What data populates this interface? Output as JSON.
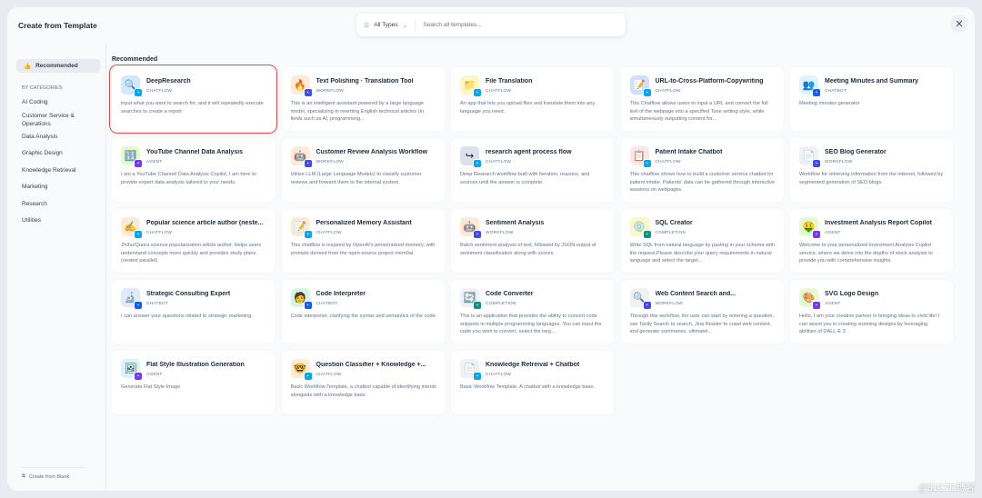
{
  "header": {
    "title": "Create from Template",
    "close": "✕",
    "filter_label": "All Types",
    "search_placeholder": "Search all templates..."
  },
  "sidebar": {
    "recommended": "Recommended",
    "by_categories": "BY CATEGORIES",
    "categories": [
      "AI Coding",
      "Customer Service & Operations",
      "Data Analysis",
      "Graphic Design",
      "Knowledge Retrieval",
      "Marketing",
      "Research",
      "Utilities"
    ],
    "create_blank": "Create from Blank"
  },
  "main": {
    "section_title": "Recommended",
    "templates": [
      {
        "name": "DeepResearch",
        "type": "CHATFLOW",
        "desc": "input what you want to search for, and it will repeatedly execute searches to create a report",
        "icon": "🔍",
        "bg": "#d1e9ff",
        "selected": true
      },
      {
        "name": "Text Polishing · Translation Tool",
        "type": "WORKFLOW",
        "desc": "This is an intelligent assistant powered by a large language model, specializing in rewriting English technical articles (in fields such as AI, programming...",
        "icon": "🔥",
        "bg": "#ffead5"
      },
      {
        "name": "File Translation",
        "type": "CHATFLOW",
        "desc": "An app that lets you upload files and translate them into any language you need.",
        "icon": "📁",
        "bg": "#fef7c3"
      },
      {
        "name": "URL-to-Cross-Platform-Copywriting",
        "type": "CHATFLOW",
        "desc": "This Chatflow allows users to input a URL and convert the full text of the webpage into a specified Tone writing style, while simultaneously outputting content for...",
        "icon": "📝",
        "bg": "#d1e0ff"
      },
      {
        "name": "Meeting Minutes and Summary",
        "type": "CHATBOT",
        "desc": "Meeting minutes generator",
        "icon": "👥",
        "bg": "#e0f2fe"
      },
      {
        "name": "YouTube Channel Data Analysis",
        "type": "AGENT",
        "desc": "I am a YouTube Channel Data Analysis Copilot, I am here to provide expert data analysis tailored to your needs.",
        "icon": "🔢",
        "bg": "#e3fbcc"
      },
      {
        "name": "Customer Review Analysis Workflow",
        "type": "WORKFLOW",
        "desc": "Utilize LLM (Large Language Models) to classify customer reviews and forward them to the internal system.",
        "icon": "🤖",
        "bg": "#ffead5"
      },
      {
        "name": "research agent process flow",
        "type": "CHATFLOW",
        "desc": "Deep Research workflow built with iteration, reasons, and sources until the answer is complete.",
        "icon": "↪",
        "bg": "#dde1ee"
      },
      {
        "name": "Patient Intake Chatbot",
        "type": "CHATFLOW",
        "desc": "This chatflow shows how to build a customer service chatbot for patient intake. Patients' data can be gathered through interactive sessions on webpages.",
        "icon": "📋",
        "bg": "#ffe4e8"
      },
      {
        "name": "SEO Blog Generator",
        "type": "WORKFLOW",
        "desc": "Workflow for retrieving information from the internet, followed by segmented generation of SEO blogs.",
        "icon": "📄",
        "bg": "#eff1f5"
      },
      {
        "name": "Popular science article author (neste...",
        "type": "CHATFLOW",
        "desc": "Zhihu/Quora science popularization article author. Helps users understand concepts more quickly and provides study plans. (nested parallel)",
        "icon": "✍",
        "bg": "#ffead5"
      },
      {
        "name": "Personalized Memory Assistant",
        "type": "CHATFLOW",
        "desc": "This chatflow is inspired by OpenAI's personalized memory, with prompts derived from the open-source project mem0ai.",
        "icon": "📝",
        "bg": "#ffead5"
      },
      {
        "name": "Sentiment Analysis",
        "type": "WORKFLOW",
        "desc": "Batch sentiment analysis of text, followed by JSON output of sentiment classification along with scores.",
        "icon": "🤖",
        "bg": "#ffead5"
      },
      {
        "name": "SQL Creator",
        "type": "COMPLETION",
        "desc": "Write SQL from natural language by pasting in your schema with the request.Please describe your query requirements in natural language and select the target...",
        "icon": "💿",
        "bg": "#fef7c3"
      },
      {
        "name": "Investment Analysis Report Copilot",
        "type": "AGENT",
        "desc": "Welcome to your personalized Investment Analysis Copilot service, where we delve into the depths of stock analysis to provide you with comprehensive insights.",
        "icon": "🤑",
        "bg": "#e3fbcc"
      },
      {
        "name": "Strategic Consulting Expert",
        "type": "CHATBOT",
        "desc": "I can answer your questions related to strategic marketing.",
        "icon": "🔬",
        "bg": "#e0eaff"
      },
      {
        "name": "Code Interpreter",
        "type": "CHATBOT",
        "desc": "Code interpreter, clarifying the syntax and semantics of the code.",
        "icon": "🧑",
        "bg": "#d3f8df"
      },
      {
        "name": "Code Converter",
        "type": "COMPLETION",
        "desc": "This is an application that provides the ability to convert code snippets in multiple programming languages. You can input the code you wish to convert, select the targ...",
        "icon": "🔄",
        "bg": "#eff1f5"
      },
      {
        "name": "Web Content Search and...",
        "type": "WORKFLOW",
        "desc": "Through this workflow, the user can start by entering a question, use Tavily Search to search, Jina Reader to crawl web content, and generate summaries, ultimatel...",
        "icon": "🔍",
        "bg": "#eff1f5"
      },
      {
        "name": "SVG Logo Design",
        "type": "AGENT",
        "desc": "Hello, I am your creative partner in bringing ideas to vivid life! I can assist you in creating stunning designs by leveraging abilities of DALL·E 3.",
        "icon": "🎨",
        "bg": "#e3fbcc"
      },
      {
        "name": "Flat Style Illustration Generation",
        "type": "AGENT",
        "desc": "Generate Flat Style Image",
        "icon": "🖼",
        "bg": "#d5f5f6"
      },
      {
        "name": "Question Classifier + Knowledge +...",
        "type": "CHATFLOW",
        "desc": "Basic Workflow Template, a chatbot capable of identifying intents alongside with a knowledge base.",
        "icon": "🤓",
        "bg": "#ffead5"
      },
      {
        "name": "Knowledge Retreival + Chatbot",
        "type": "CHATFLOW",
        "desc": "Basic Workflow Template, A chatbot with a knowledge base.",
        "icon": "📄",
        "bg": "#eff1f5"
      }
    ]
  },
  "type_colors": {
    "CHATFLOW": "#0ba5ec",
    "WORKFLOW": "#444ce7",
    "CHATBOT": "#155eef",
    "AGENT": "#7839ee",
    "COMPLETION": "#0e9384"
  },
  "watermark": "@51CTO博客"
}
